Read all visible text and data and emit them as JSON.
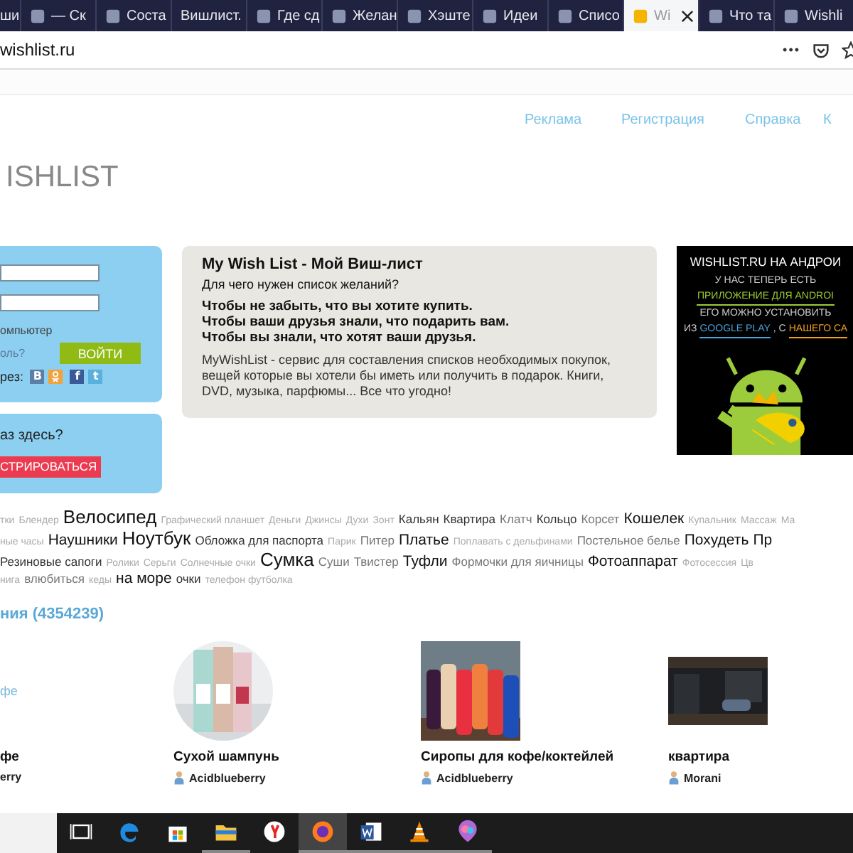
{
  "browser": {
    "tabs": [
      {
        "label": "ши",
        "favicon": false,
        "selected": false
      },
      {
        "label": "— Ск",
        "favicon": true,
        "selected": false
      },
      {
        "label": "Соста",
        "favicon": true,
        "selected": false
      },
      {
        "label": "Вишлист.",
        "favicon": false,
        "selected": false
      },
      {
        "label": "Где сд",
        "favicon": true,
        "selected": false
      },
      {
        "label": "Желан",
        "favicon": true,
        "selected": false
      },
      {
        "label": "Хэште",
        "favicon": true,
        "selected": false
      },
      {
        "label": "Идеи",
        "favicon": true,
        "selected": false
      },
      {
        "label": "Списо",
        "favicon": true,
        "selected": false
      },
      {
        "label": "Wi",
        "favicon": true,
        "selected": true
      },
      {
        "label": "Что та",
        "favicon": true,
        "selected": false
      },
      {
        "label": "Wishli",
        "favicon": true,
        "selected": false
      }
    ],
    "address": "wishlist.ru",
    "menu_glyph": "•••"
  },
  "nav": [
    "Реклама",
    "Регистрация",
    "Справка",
    "К"
  ],
  "logo": "ISHLIST",
  "login": {
    "remember": "омпьютер",
    "forgot": "оль?",
    "submit": "ВОЙТИ",
    "via": "рез:",
    "social": [
      {
        "kind": "vk",
        "glyph": "В"
      },
      {
        "kind": "ok"
      },
      {
        "kind": "fb",
        "glyph": "f"
      },
      {
        "kind": "tw",
        "glyph": "t"
      }
    ]
  },
  "signup": {
    "question": "аз здесь?",
    "button": "СТРИРОВАТЬСЯ"
  },
  "intro": {
    "title": "My Wish List - Мой Виш-лист",
    "question": "Для чего нужен список желаний?",
    "reasons": [
      "Чтобы не забыть, что вы хотите купить.",
      "Чтобы ваши друзья знали, что подарить вам.",
      "Чтобы вы знали, что хотят ваши друзья."
    ],
    "description": "MyWishList - сервис для составления списков необходимых покупок, вещей которые вы хотели бы иметь или получить в подарок. Книги, DVD, музыка, парфюмы... Все что угодно!"
  },
  "banner": {
    "title": "WISHLIST.RU НА АНДРОИ",
    "lines": [
      [
        {
          "text": "У НАС ТЕПЕРЬ ЕСТЬ",
          "kind": "text"
        }
      ],
      [
        {
          "text": "ПРИЛОЖЕНИЕ ДЛЯ ANDROI",
          "kind": "link",
          "color": "#9acd32"
        }
      ],
      [
        {
          "text": "ЕГО МОЖНО УСТАНОВИТЬ",
          "kind": "text"
        }
      ],
      [
        {
          "text": "ИЗ",
          "kind": "text"
        },
        {
          "text": "GOOGLE PLAY",
          "kind": "link",
          "color": "#4aa3df"
        },
        {
          "text": ", С",
          "kind": "text"
        },
        {
          "text": "НАШЕГО СА",
          "kind": "link",
          "color": "#f0a020"
        }
      ]
    ]
  },
  "tags": [
    [
      {
        "text": "тки",
        "kind": "s"
      },
      {
        "text": "Блендер",
        "kind": "s"
      },
      {
        "text": "Велосипед",
        "kind": "xl"
      },
      {
        "text": "Графический планшет",
        "kind": "s"
      },
      {
        "text": "Деньги",
        "kind": "s"
      },
      {
        "text": "Джинсы",
        "kind": "s"
      },
      {
        "text": "Духи",
        "kind": "s"
      },
      {
        "text": "Зонт",
        "kind": "s"
      },
      {
        "text": "Кальян",
        "kind": "m"
      },
      {
        "text": "Квартира",
        "kind": "m"
      },
      {
        "text": "Клатч",
        "kind": "g"
      },
      {
        "text": "Кольцо",
        "kind": "m"
      },
      {
        "text": "Корсет",
        "kind": "g"
      },
      {
        "text": "Кошелек",
        "kind": "l"
      },
      {
        "text": "Купальник",
        "kind": "s"
      },
      {
        "text": "Массаж",
        "kind": "s"
      },
      {
        "text": "Ма",
        "kind": "s"
      }
    ],
    [
      {
        "text": "ные часы",
        "kind": "s"
      },
      {
        "text": "Наушники",
        "kind": "l"
      },
      {
        "text": "Ноутбук",
        "kind": "xl"
      },
      {
        "text": "Обложка для паспорта",
        "kind": "m"
      },
      {
        "text": "Парик",
        "kind": "s"
      },
      {
        "text": "Питер",
        "kind": "g"
      },
      {
        "text": "Платье",
        "kind": "l"
      },
      {
        "text": "Поплавать с дельфинами",
        "kind": "s"
      },
      {
        "text": "Постельное белье",
        "kind": "g"
      },
      {
        "text": "Похудеть",
        "kind": "l"
      },
      {
        "text": "Пр",
        "kind": "l"
      }
    ],
    [
      {
        "text": "Резиновые сапоги",
        "kind": "m"
      },
      {
        "text": "Ролики",
        "kind": "s"
      },
      {
        "text": "Серьги",
        "kind": "s"
      },
      {
        "text": "Солнечные очки",
        "kind": "s"
      },
      {
        "text": "Сумка",
        "kind": "xl"
      },
      {
        "text": "Суши",
        "kind": "g"
      },
      {
        "text": "Твистер",
        "kind": "g"
      },
      {
        "text": "Туфли",
        "kind": "l"
      },
      {
        "text": "Формочки для яичницы",
        "kind": "g"
      },
      {
        "text": "Фотоаппарат",
        "kind": "l"
      },
      {
        "text": "Фотосессия",
        "kind": "s"
      },
      {
        "text": "Цв",
        "kind": "s"
      }
    ],
    [
      {
        "text": "нига",
        "kind": "s"
      },
      {
        "text": "влюбиться",
        "kind": "g"
      },
      {
        "text": "кеды",
        "kind": "s"
      },
      {
        "text": "на море",
        "kind": "l"
      },
      {
        "text": "очки",
        "kind": "m"
      },
      {
        "text": "телефон футболка",
        "kind": "s"
      }
    ]
  ],
  "section_title": "ния (4354239)",
  "products": [
    {
      "alt": "фе",
      "title": "фе",
      "user": "erry",
      "kind": "broken"
    },
    {
      "title": "Сухой шампунь",
      "user": "Acidblueberry",
      "kind": "round"
    },
    {
      "title": "Сиропы для кофе/коктейлей",
      "user": "Acidblueberry",
      "kind": "square"
    },
    {
      "title": "квартира",
      "user": "Morani",
      "kind": "wide"
    }
  ],
  "taskbar": [
    {
      "kind": "taskview",
      "running": false,
      "selected": false
    },
    {
      "kind": "edge",
      "running": false,
      "selected": false
    },
    {
      "kind": "store",
      "running": false,
      "selected": false
    },
    {
      "kind": "folder",
      "running": true,
      "selected": false
    },
    {
      "kind": "yandex",
      "running": false,
      "selected": false
    },
    {
      "kind": "firefox",
      "running": true,
      "selected": true
    },
    {
      "kind": "word",
      "running": true,
      "selected": false
    },
    {
      "kind": "vlc",
      "running": true,
      "selected": false
    },
    {
      "kind": "paint",
      "running": true,
      "selected": false
    }
  ]
}
